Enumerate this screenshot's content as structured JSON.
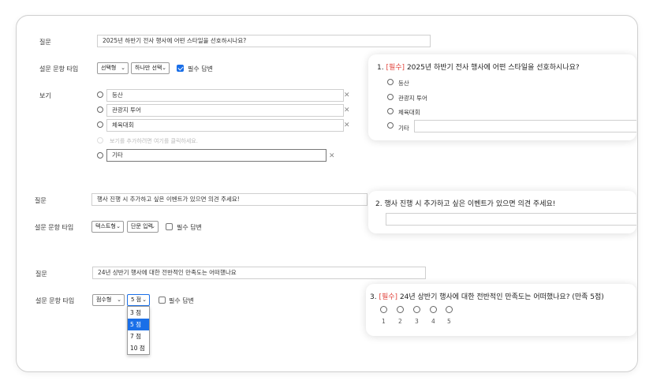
{
  "q1": {
    "question_label": "질문",
    "question_value": "2025년 하반기 전사 행사에 어떤 스타일을 선호하시나요?",
    "type_label": "설문 문항 타입",
    "type_select": "선택형",
    "mode_select": "하나만 선택",
    "required_label": "필수 답변",
    "options_label": "보기",
    "options": [
      "등산",
      "관광지 투어",
      "체육대회"
    ],
    "add_hint": "보기를 추가하려면 여기를 클릭하세요.",
    "other_value": "기타",
    "preview": {
      "number": "1.",
      "required_tag": "[필수]",
      "title": "2025년 하반기 전사 행사에 어떤 스타일을 선호하시나요?",
      "options": [
        "등산",
        "관광지 투어",
        "체육대회",
        "기타"
      ]
    }
  },
  "q2": {
    "question_label": "질문",
    "question_value": "행사 진행 시 추가하고 싶은 이벤트가 있으면 의견 주세요!",
    "type_label": "설문 문항 타입",
    "type_select": "텍스트형",
    "mode_select": "단문 입력",
    "required_label": "필수 답변",
    "preview": {
      "title": "2. 행사 진행 시 추가하고 싶은 이벤트가 있으면 의견 주세요!"
    }
  },
  "q3": {
    "question_label": "질문",
    "question_value": "24년 상반기 행사에 대한 전반적인 만족도는 어떠했나요",
    "type_label": "설문 문항 타입",
    "type_select": "점수형",
    "score_select": "5 점",
    "required_label": "필수 답변",
    "dropdown_items": [
      "3 점",
      "5 점",
      "7 점",
      "10 점"
    ],
    "dropdown_selected_index": 1,
    "preview": {
      "number": "3.",
      "required_tag": "[필수]",
      "title": "24년 상반기 행사에 대한 전반적인 만족도는 어떠했나요? (만족 5점)",
      "scale": [
        "1",
        "2",
        "3",
        "4",
        "5"
      ]
    }
  },
  "colors": {
    "accent": "#1a6fe8",
    "required": "#e0443c"
  }
}
